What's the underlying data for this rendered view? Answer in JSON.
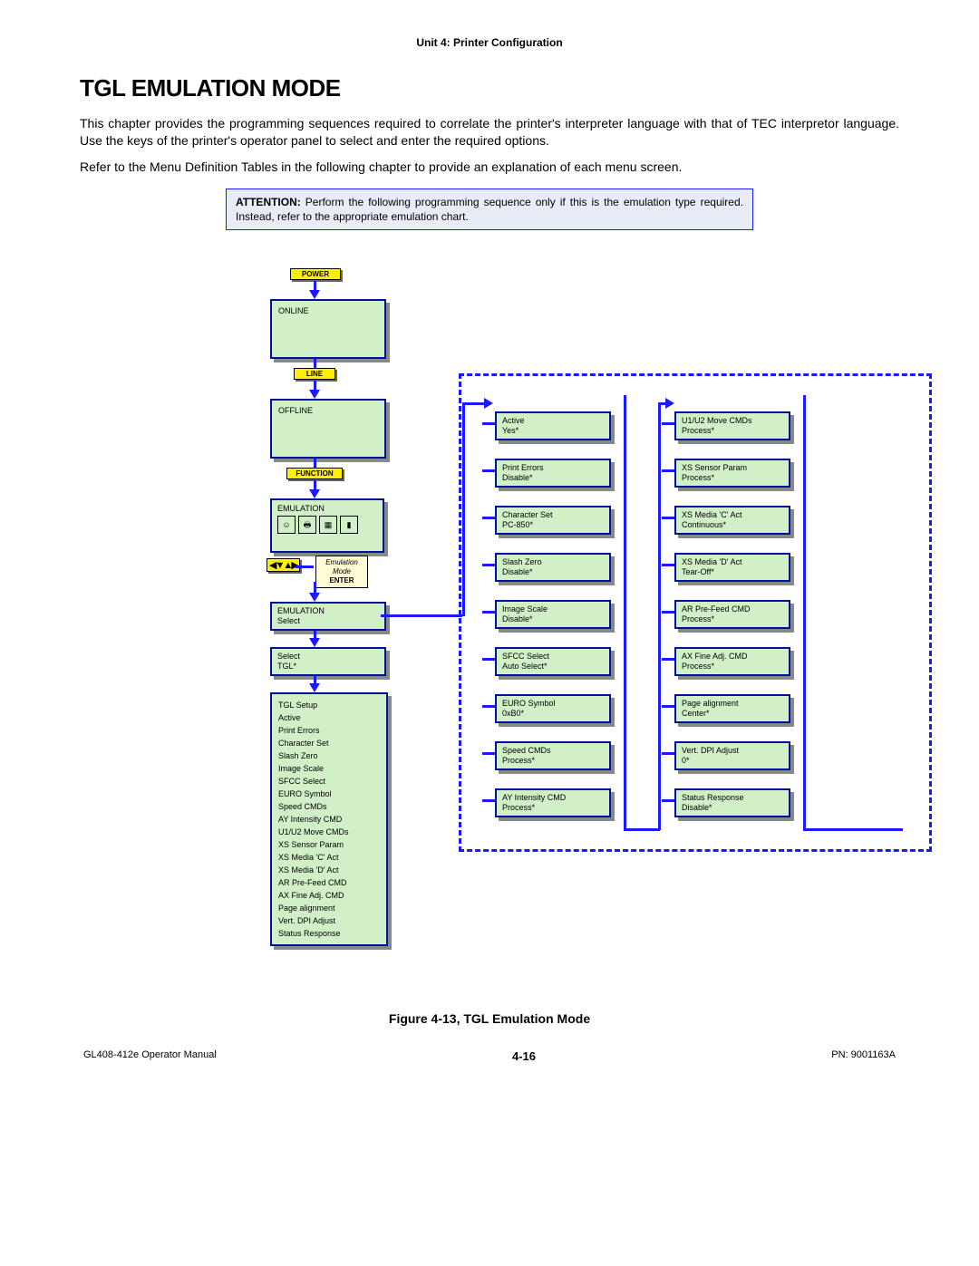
{
  "header_unit": "Unit 4: Printer Configuration",
  "title": "TGL EMULATION MODE",
  "para1": "This chapter provides the programming sequences required to correlate the printer's interpreter language with that of TEC interpretor language. Use the keys of the printer's operator panel to select and enter the required options.",
  "para2": "Refer to the Menu Definition Tables in the following chapter to provide an explanation of each menu screen.",
  "notice_lead": "ATTENTION:",
  "notice_body": " Perform the following programming sequence only if this is the emulation type required. Instead, refer to the appropriate emulation chart.",
  "btn_power": "POWER",
  "btn_line": "LINE",
  "btn_function": "FUNCTION",
  "box_online": "ONLINE",
  "box_offline": "OFFLINE",
  "box_emulation_hdr": "EMULATION",
  "note_line1": "Emulation",
  "note_line2": "Mode",
  "note_enter": "ENTER",
  "sel_box1_l1": "EMULATION",
  "sel_box1_l2": "Select",
  "sel_box2_l1": "Select",
  "sel_box2_l2": "TGL*",
  "list_title": "TGL Setup",
  "list_items": [
    "Active",
    "Print Errors",
    "Character Set",
    "Slash Zero",
    "Image Scale",
    "SFCC Select",
    "EURO Symbol",
    "Speed CMDs",
    "AY Intensity CMD",
    "U1/U2 Move CMDs",
    "XS Sensor Param",
    "XS Media 'C' Act",
    "XS Media 'D' Act",
    "AR Pre-Feed CMD",
    "AX Fine Adj. CMD",
    "Page alignment",
    "Vert. DPI Adjust",
    "Status Response"
  ],
  "colA": [
    {
      "l1": "Active",
      "l2": "Yes*"
    },
    {
      "l1": "Print Errors",
      "l2": "Disable*"
    },
    {
      "l1": "Character Set",
      "l2": "PC-850*"
    },
    {
      "l1": "Slash Zero",
      "l2": "Disable*"
    },
    {
      "l1": "Image Scale",
      "l2": "Disable*"
    },
    {
      "l1": "SFCC Select",
      "l2": "Auto Select*"
    },
    {
      "l1": "EURO Symbol",
      "l2": "0xB0*"
    },
    {
      "l1": "Speed CMDs",
      "l2": "Process*"
    },
    {
      "l1": "AY Intensity CMD",
      "l2": "Process*"
    }
  ],
  "colB": [
    {
      "l1": "U1/U2 Move CMDs",
      "l2": "Process*"
    },
    {
      "l1": "XS Sensor Param",
      "l2": "Process*"
    },
    {
      "l1": "XS Media 'C' Act",
      "l2": "Continuous*"
    },
    {
      "l1": "XS Media 'D' Act",
      "l2": "Tear-Off*"
    },
    {
      "l1": "AR Pre-Feed CMD",
      "l2": "Process*"
    },
    {
      "l1": "AX Fine Adj. CMD",
      "l2": "Process*"
    },
    {
      "l1": "Page alignment",
      "l2": "Center*"
    },
    {
      "l1": "Vert. DPI Adjust",
      "l2": "0*"
    },
    {
      "l1": "Status Response",
      "l2": "Disable*"
    }
  ],
  "figure_caption": "Figure 4-13, TGL Emulation Mode",
  "footer_left": "GL408-412e Operator Manual",
  "footer_center": "4-16",
  "footer_right": "PN: 9001163A"
}
